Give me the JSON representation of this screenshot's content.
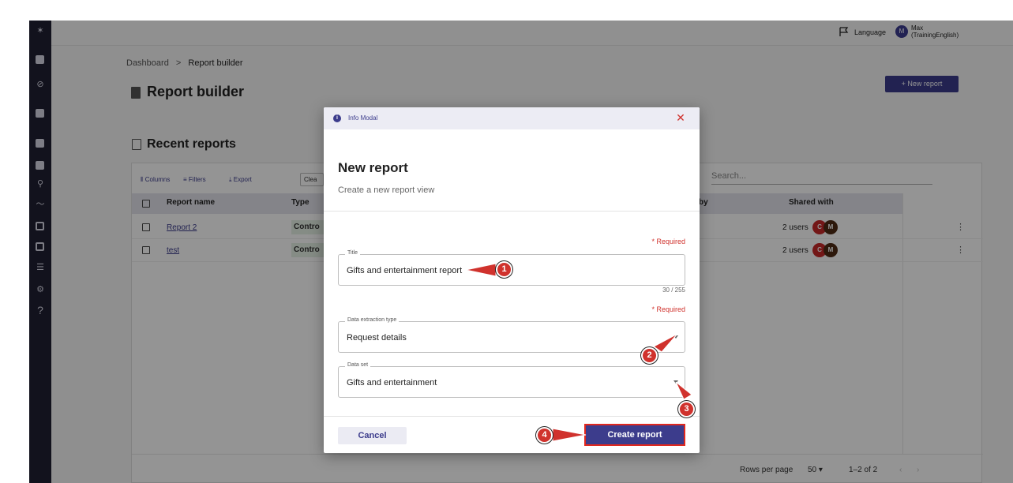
{
  "topbar": {
    "language_label": "Language",
    "avatar_initial": "M",
    "user_name_line1": "Max",
    "user_name_line2": "(TrainingEnglish)"
  },
  "breadcrumb": {
    "root": "Dashboard",
    "separator": ">",
    "current": "Report builder"
  },
  "page": {
    "title": "Report builder",
    "new_report_label": "+  New report"
  },
  "recent": {
    "title": "Recent reports",
    "toolbar": {
      "columns": "Columns",
      "filters": "Filters",
      "export": "Export",
      "clear": "Clea",
      "search_placeholder": "Search..."
    },
    "headers": {
      "report_name": "Report name",
      "type": "Type",
      "by": "by",
      "shared_with": "Shared with"
    },
    "rows": [
      {
        "name": "Report 2",
        "type": "Contro",
        "shared": "2 users",
        "av1": "C",
        "av2": "M"
      },
      {
        "name": "test",
        "type": "Contro",
        "shared": "2 users",
        "av1": "C",
        "av2": "M"
      }
    ],
    "footer": {
      "rows_per_page_label": "Rows per page",
      "rows_per_page_value": "50",
      "range": "1–2 of 2"
    }
  },
  "modal": {
    "header_label": "Info Modal",
    "title": "New report",
    "subtitle": "Create a new report view",
    "required_label": "* Required",
    "title_field": {
      "label": "Title",
      "value": "Gifts and entertainment report",
      "counter": "30 / 255"
    },
    "extraction_field": {
      "label": "Data extraction type",
      "value": "Request details"
    },
    "dataset_field": {
      "label": "Data set",
      "value": "Gifts and entertainment"
    },
    "cancel_label": "Cancel",
    "create_label": "Create report"
  },
  "callouts": [
    "1",
    "2",
    "3",
    "4"
  ],
  "colors": {
    "sidebar": "#1f1f33",
    "accent": "#3c3c8c",
    "callout": "#d0322d",
    "avatar_c": "#c62828",
    "avatar_m": "#4e2a14"
  }
}
